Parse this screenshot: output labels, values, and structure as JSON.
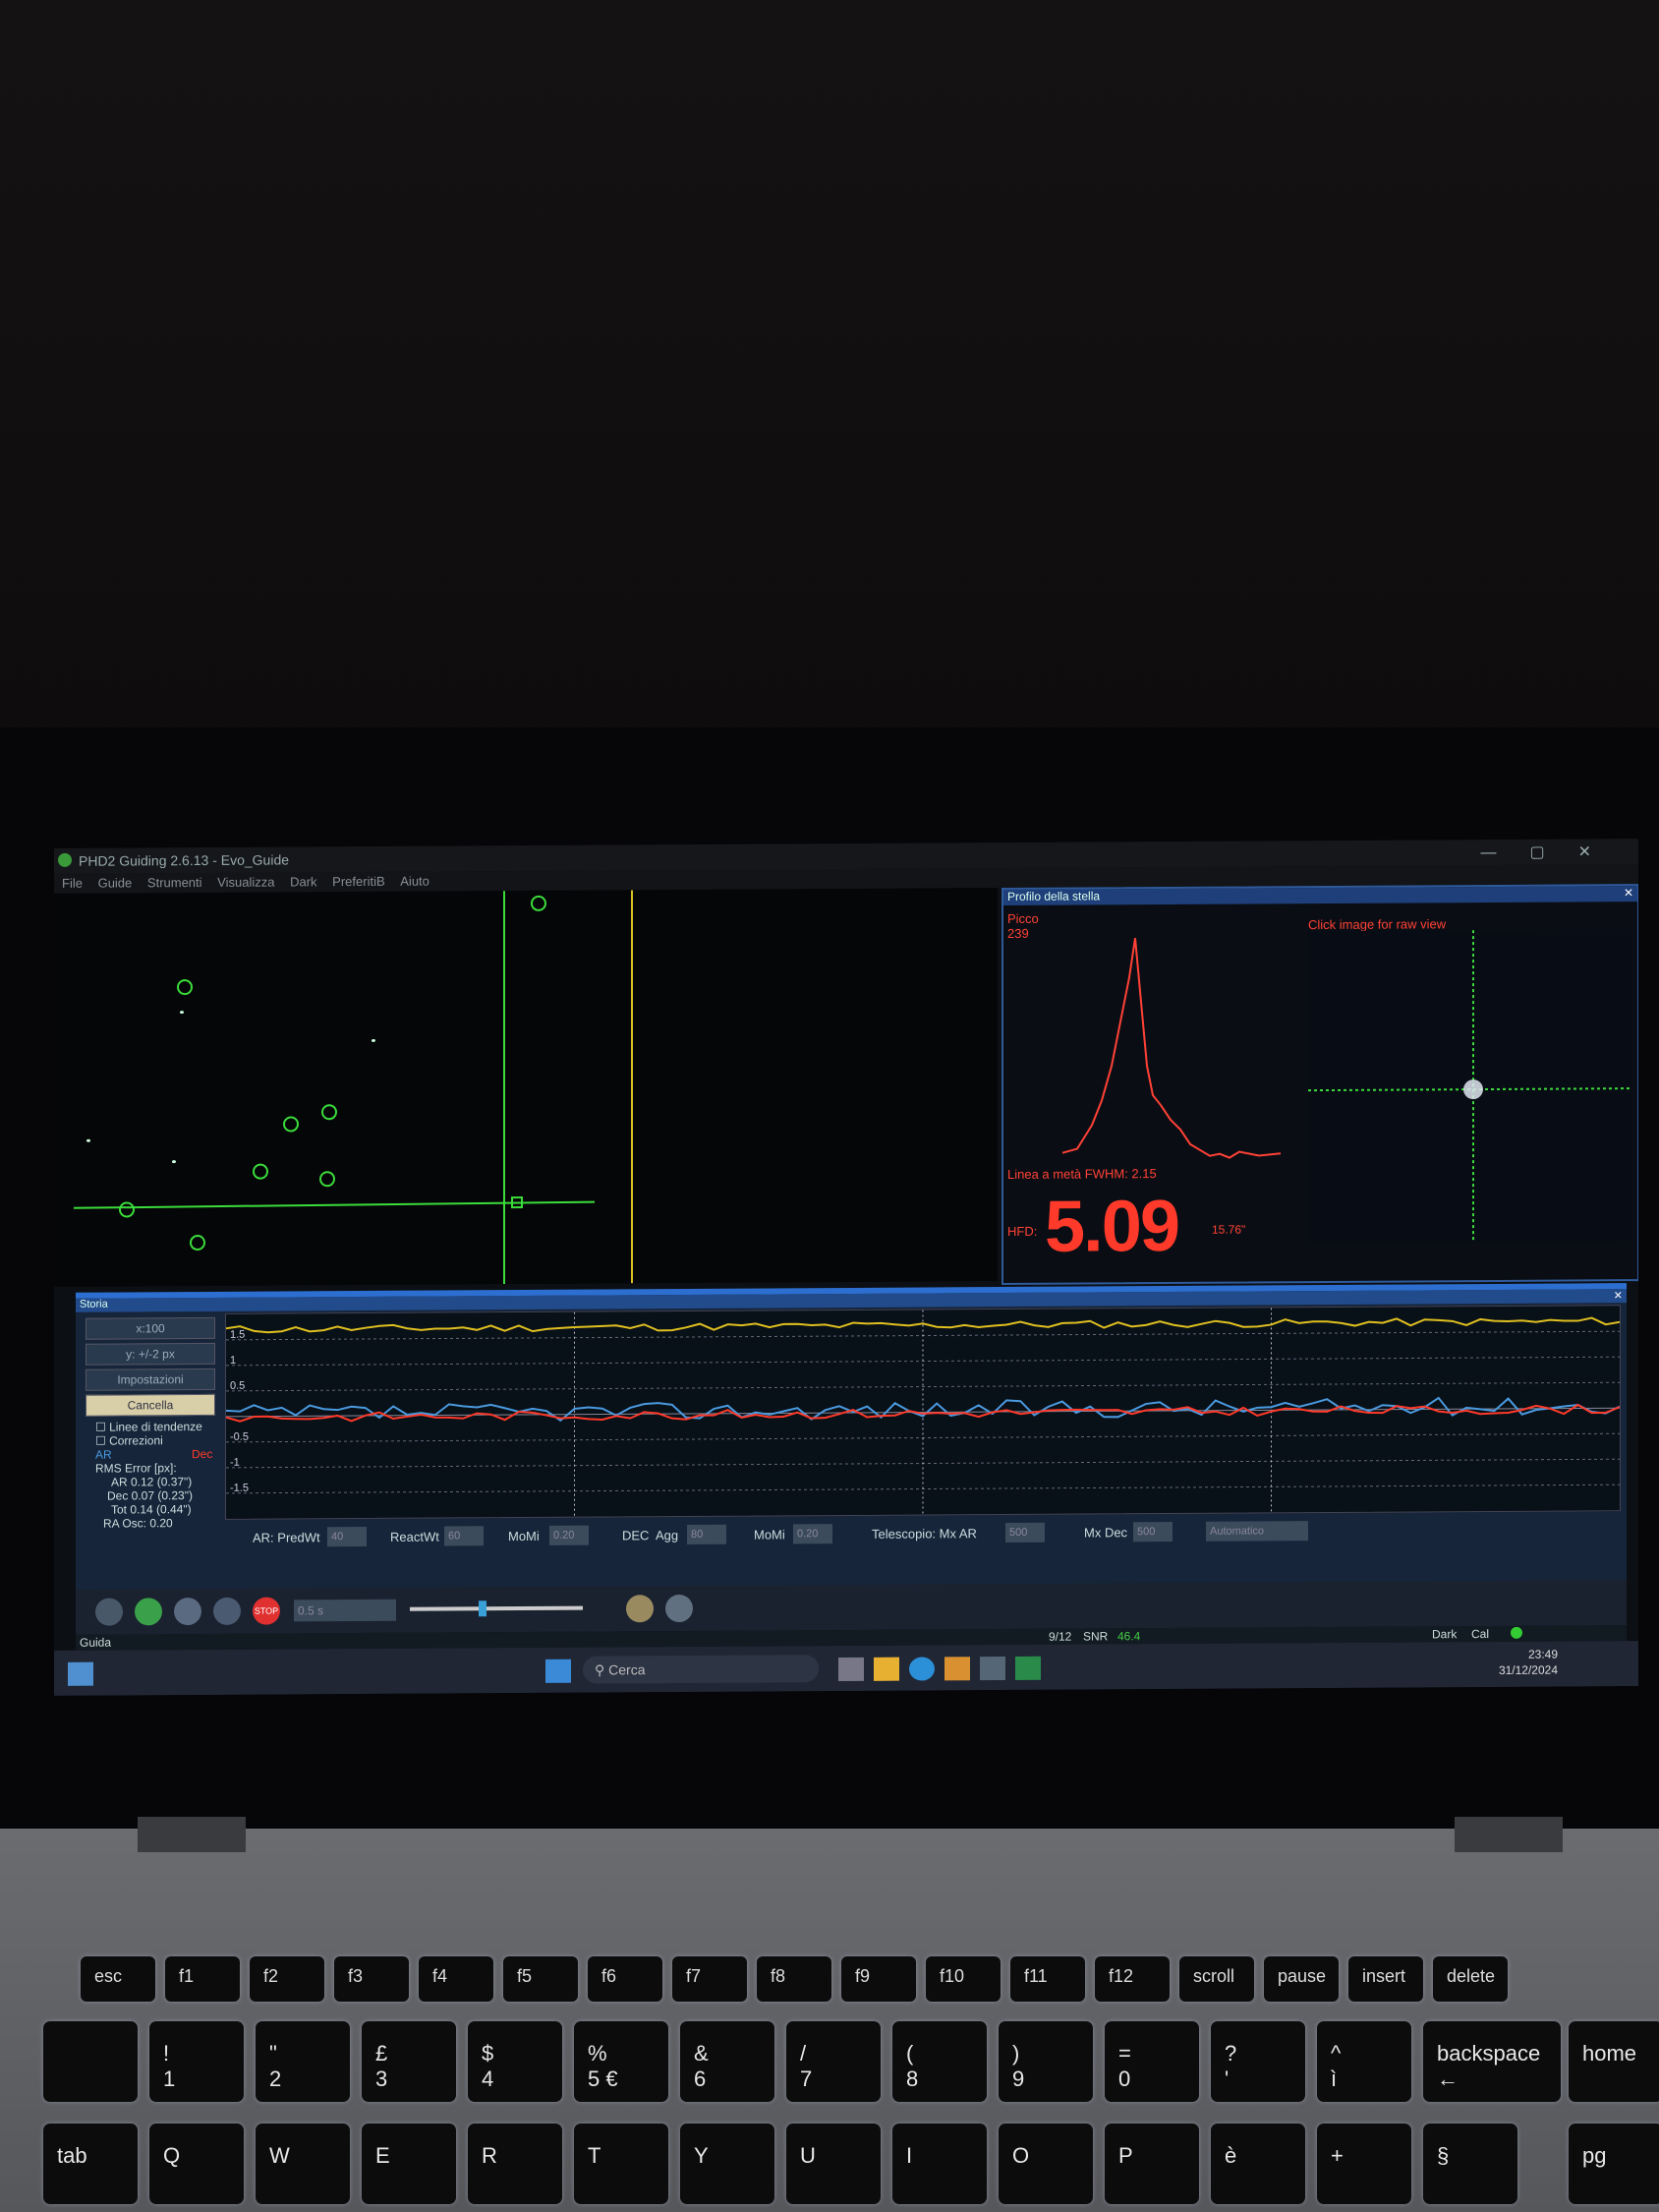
{
  "window": {
    "title": "PHD2 Guiding 2.6.13 - Evo_Guide",
    "controls": [
      "—",
      "▢",
      "✕"
    ]
  },
  "menu": [
    "File",
    "Guide",
    "Strumenti",
    "Visualizza",
    "Dark",
    "PreferitiB",
    "Aiuto"
  ],
  "profile": {
    "header": "Profilo della stella",
    "peak_label": "Picco",
    "peak_value": "239",
    "raw_hint": "Click image for raw view",
    "fwhm_label": "Linea a metà FWHM: 2.15",
    "hfd_label": "HFD:",
    "hfd_value": "5.09",
    "hfd_arcsec": "15.76\""
  },
  "history": {
    "header": "Storia",
    "x_scale": "x:100",
    "y_scale": "y: +/-2 px",
    "settings": "Impostazioni",
    "clear": "Cancella",
    "trend_lines": "Linee di tendenze",
    "corrections": "Correzioni",
    "ar_label": "AR",
    "dec_label": "Dec",
    "rms_title": "RMS Error [px]:",
    "rms_ar": "AR 0.12 (0.37\")",
    "rms_dec": "Dec 0.07 (0.23\")",
    "rms_tot": "Tot 0.14 (0.44\")",
    "ra_osc": "RA Osc: 0.20",
    "y_ticks": [
      "1.5",
      "1",
      "0.5",
      "-0.5",
      "-1",
      "-1.5"
    ],
    "ar_series_color": "#4a9adf",
    "dec_series_color": "#ff3a2a",
    "snr_series_color": "#e0c020"
  },
  "params": {
    "ar_label": "AR: PredWt",
    "ar_predwt": "40",
    "react_label": "ReactWt",
    "react_value": "60",
    "momi_label": "MoMi",
    "momi_value": "0.20",
    "dec_label": "DEC",
    "agg_label": "Agg",
    "agg_value": "80",
    "momi2_label": "MoMi",
    "momi2_value": "0.20",
    "tel_label": "Telescopio: Mx AR",
    "mx_ar": "500",
    "mx_dec_label": "Mx Dec",
    "mx_dec": "500",
    "mode": "Automatico"
  },
  "toolbar": {
    "exposure": "0.5 s",
    "stop": "STOP"
  },
  "status": {
    "mode": "Guida",
    "frame": "9/12",
    "snr_label": "SNR",
    "snr_value": "46.4",
    "dark": "Dark",
    "cal": "Cal"
  },
  "taskbar": {
    "search": "Cerca",
    "time": "23:49",
    "date": "31/12/2024"
  },
  "keyboard": {
    "fn_keys": [
      "esc",
      "f1",
      "f2",
      "f3",
      "f4",
      "f5",
      "f6",
      "f7",
      "f8",
      "f9",
      "f10",
      "f11",
      "f12",
      "scroll",
      "pause",
      "insert",
      "delete"
    ],
    "num_row": [
      "",
      "!\n1",
      "\"\n2",
      "£\n3",
      "$\n4",
      "%\n5 €",
      "&\n6",
      "/\n7",
      "(\n8",
      ")\n9",
      "=\n0",
      "?\n'",
      "^\nì",
      "backspace\n←",
      "home"
    ],
    "top_row": [
      "tab",
      "Q",
      "W",
      "E",
      "R",
      "T",
      "Y",
      "U",
      "I",
      "O",
      "P",
      "è",
      "+",
      "§",
      "pg"
    ]
  }
}
